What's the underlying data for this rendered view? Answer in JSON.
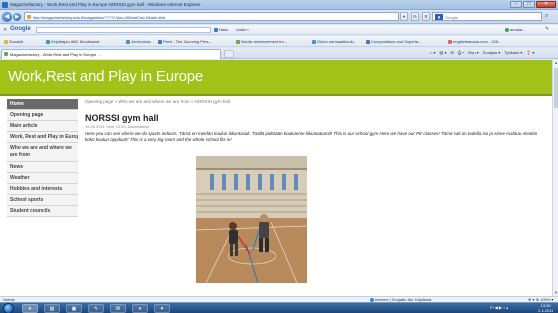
{
  "window": {
    "title": "Magazinefactory - Work,Rest and Play in Europe NORSSI gym hall - Windows Internet Explorer",
    "min_glyph": "–",
    "max_glyph": "□",
    "close_glyph": "✕"
  },
  "address": {
    "url": "http://magazinefactory.edu.fi/magazines/????/?doc=80&artCat=0&aid=###",
    "search_placeholder": "Google",
    "back_glyph": "◀",
    "forward_glyph": "▶",
    "search_glyph": "⌕",
    "tools": [
      "▾",
      "⟳",
      "✕"
    ]
  },
  "google_toolbar": {
    "close_glyph": "✕",
    "logo": "Google",
    "haku": "Haku",
    "lisaa": "Lisää »",
    "user": "annala...",
    "wrench_glyph": "✎"
  },
  "favorites": [
    {
      "label": "Suosikit",
      "color": "#e8b631"
    },
    {
      "label": "Kirjoittajan ABC Muotisanat",
      "color": "#4a90d9"
    },
    {
      "label": "Jonet-tavia",
      "color": "#4a90d9"
    },
    {
      "label": "Prezi - The Zooming Pres...",
      "color": "#2f7ed8"
    },
    {
      "label": "Nordic reinforcement fro...",
      "color": "#6aa84f"
    },
    {
      "label": "Oulun normaalikoulu",
      "color": "#4a90d9"
    },
    {
      "label": "Compositions and Superla...",
      "color": "#3c78d8"
    },
    {
      "label": "englishbanana.com - 106...",
      "color": "#e06666"
    }
  ],
  "tab": {
    "label": "Magazinefactory - Work,Rest and Play in Europe ...",
    "new_tab_glyph": "+"
  },
  "commands": [
    "⌂ ▾",
    "▤ ▾",
    "✉",
    "⎙ ▾",
    "Sivu ▾",
    "Suojaus ▾",
    "Työkalut ▾",
    "❓ ▾"
  ],
  "site": {
    "title": "Work,Rest and Play in Europe"
  },
  "sidebar": {
    "items": [
      {
        "label": "Home"
      },
      {
        "label": "Opening page"
      },
      {
        "label": "Main article"
      },
      {
        "label": "Work, Rest and Play in Europe"
      },
      {
        "label": "Who we are and where we are from"
      },
      {
        "label": "News"
      },
      {
        "label": "Weather"
      },
      {
        "label": "Hobbies and interests"
      },
      {
        "label": "School sports"
      },
      {
        "label": "Student councils"
      }
    ]
  },
  "article": {
    "breadcrumb": "Opening page » Who we are and where we are from » NORSSI gym hall",
    "title": "NORSSI gym hall",
    "meta": "15.02.2011 Time 10:53, Aattonatsari",
    "body": "Here you can see where we do sports indoors. Tämä on meidän koulun liikuntasali. Täällä pidetään koulumme liikuntatunnit! This is our school gym Here we have our PE classes! Tämä sali on todella iso ja sinne mahtuu meidän koko koulun oppilaat!! This is a very big room and the whole school fits in!"
  },
  "status": {
    "text": "Valmis",
    "zone": "Internet | Suojattu tila: Käytössä",
    "zoom": "⊕ ▾  ⊕ 105% ▾"
  },
  "taskbar": {
    "buttons": [
      "e",
      "▤",
      "▣",
      "✎",
      "W",
      "e",
      "✦"
    ],
    "tray": "FI ◀ ▶ ♪ ▴",
    "time": "13:35",
    "date": "2.4.2011"
  }
}
